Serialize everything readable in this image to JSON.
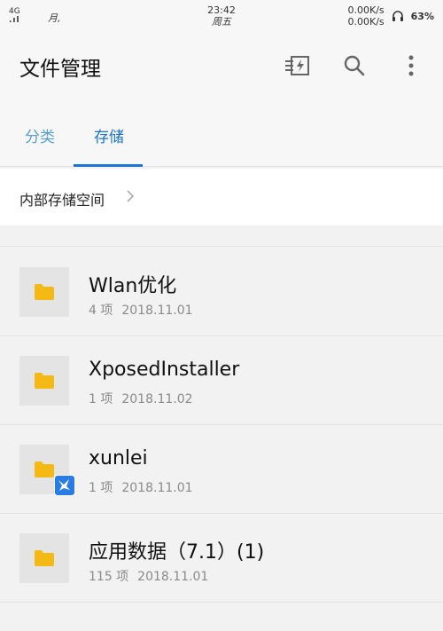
{
  "status": {
    "network": "4G",
    "signal": ".ıl",
    "carrier": "月,",
    "time": "23:42",
    "weekday": "周五",
    "upload_speed": "0.00K/s",
    "download_speed": "0.00K/s",
    "battery": "63%"
  },
  "app": {
    "title": "文件管理"
  },
  "icons": {
    "tool": "flash-storage-icon",
    "search": "search-icon",
    "more": "more-vert-icon"
  },
  "tabs": [
    {
      "label": "分类",
      "selected": false
    },
    {
      "label": "存储",
      "selected": true
    }
  ],
  "breadcrumb": {
    "label": "内部存储空间"
  },
  "items": [
    {
      "name": "Wlan优化",
      "count": "4 项",
      "date": "2018.11.01",
      "badge": false
    },
    {
      "name": "XposedInstaller",
      "count": "1 项",
      "date": "2018.11.02",
      "badge": false
    },
    {
      "name": "xunlei",
      "count": "1 项",
      "date": "2018.11.01",
      "badge": true
    },
    {
      "name": "应用数据（7.1）(1)",
      "count": "115 项",
      "date": "2018.11.01",
      "badge": false
    }
  ],
  "colors": {
    "accent": "#1a73d9",
    "folder": "#f5b915",
    "badge": "#2a7be4"
  }
}
